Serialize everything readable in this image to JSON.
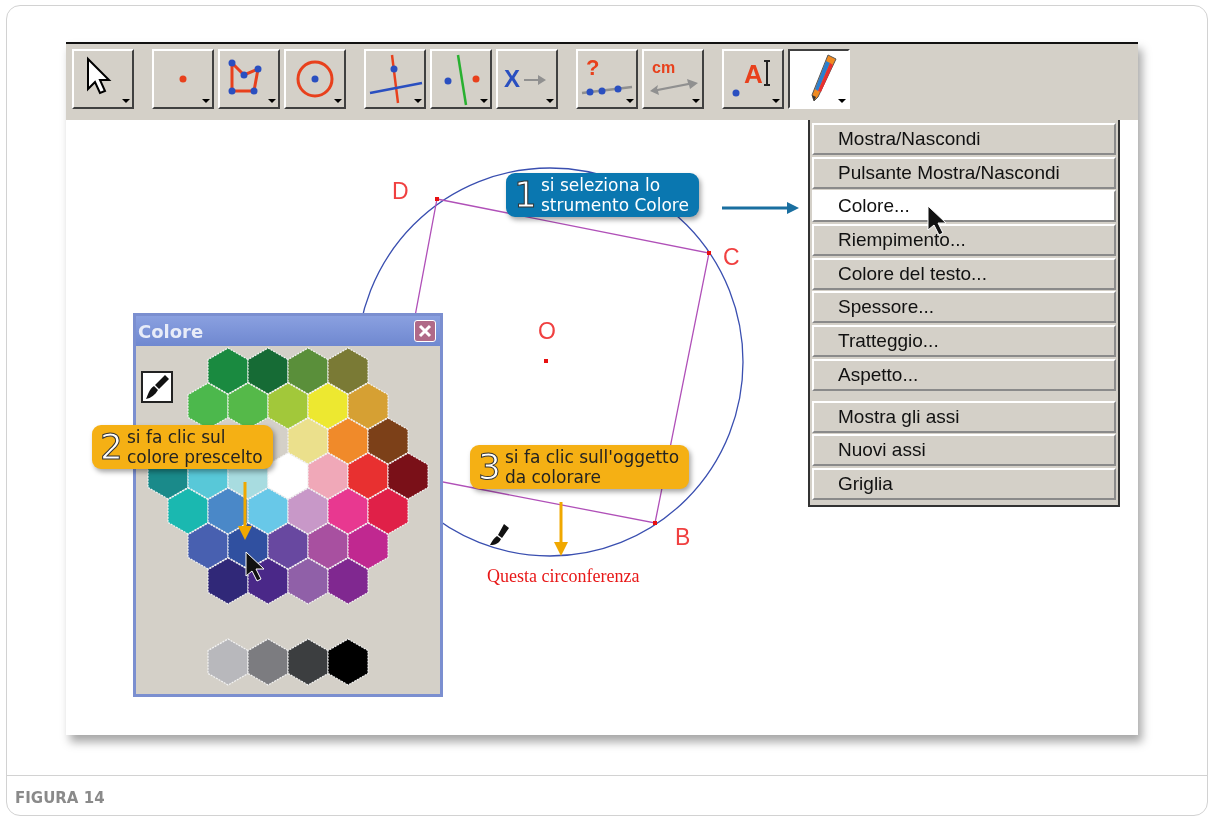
{
  "toolbar": {
    "groups": [
      [
        {
          "kind": "pointer",
          "selected": false
        }
      ],
      [
        {
          "kind": "point",
          "selected": false
        },
        {
          "kind": "polygon",
          "selected": false
        },
        {
          "kind": "circle",
          "selected": false
        }
      ],
      [
        {
          "kind": "perpendicular",
          "selected": false
        },
        {
          "kind": "parallel",
          "selected": false
        },
        {
          "kind": "symmetry",
          "text": "X",
          "selected": false
        }
      ],
      [
        {
          "kind": "question",
          "text": "?",
          "selected": false
        },
        {
          "kind": "measure",
          "text": "cm",
          "selected": false
        }
      ],
      [
        {
          "kind": "label",
          "text": "A",
          "selected": false
        },
        {
          "kind": "pencil",
          "selected": true
        }
      ]
    ]
  },
  "construction": {
    "points": [
      {
        "label": "D"
      },
      {
        "label": "C"
      },
      {
        "label": "O"
      },
      {
        "label": "B"
      }
    ],
    "caption": "Questa circonferenza"
  },
  "color_window": {
    "title": "Colore",
    "palette": [
      [
        {
          "color": "#1a8a40"
        },
        {
          "color": "#166b35"
        },
        {
          "color": "#5a8f3a"
        },
        {
          "color": "#7a7a35"
        }
      ],
      [
        {
          "color": "#4cb84c"
        },
        {
          "color": "#55b949"
        },
        {
          "color": "#a2c83a"
        },
        {
          "color": "#ede830"
        },
        {
          "color": "#d6a033"
        }
      ],
      [
        {
          "color": "#ebe08c"
        },
        {
          "color": "#f08a2a"
        },
        {
          "color": "#7c4018"
        }
      ],
      [
        {
          "color": "#1a8a8a"
        },
        {
          "color": "#58c8d8"
        },
        {
          "color": "#a8dce0"
        },
        {
          "color": "#ffffff"
        },
        {
          "color": "#f0a8b8"
        },
        {
          "color": "#e83030"
        },
        {
          "color": "#7a1018"
        }
      ],
      [
        {
          "color": "#1ab8b0"
        },
        {
          "color": "#4a88c8"
        },
        {
          "color": "#68c8e8"
        },
        {
          "color": "#c898c8"
        },
        {
          "color": "#e83890"
        },
        {
          "color": "#e02048"
        }
      ],
      [
        {
          "color": "#4860b0"
        },
        {
          "color": "#3050a0"
        },
        {
          "color": "#6848a0"
        },
        {
          "color": "#a850a0"
        },
        {
          "color": "#c02890"
        }
      ],
      [
        {
          "color": "#302878"
        },
        {
          "color": "#4a2888"
        },
        {
          "color": "#9060a8"
        },
        {
          "color": "#802890"
        }
      ]
    ],
    "grays": [
      {
        "color": "#b8b8bc"
      },
      {
        "color": "#7c7c80"
      },
      {
        "color": "#3c3e40"
      },
      {
        "color": "#000000"
      }
    ]
  },
  "menu": {
    "groups": [
      [
        {
          "label": "Mostra/Nascondi",
          "selected": false
        },
        {
          "label": "Pulsante Mostra/Nascondi",
          "selected": false
        },
        {
          "label": "Colore...",
          "selected": true
        },
        {
          "label": "Riempimento...",
          "selected": false
        },
        {
          "label": "Colore del testo...",
          "selected": false
        },
        {
          "label": "Spessore...",
          "selected": false
        },
        {
          "label": "Tratteggio...",
          "selected": false
        },
        {
          "label": "Aspetto...",
          "selected": false
        }
      ],
      [
        {
          "label": "Mostra gli assi",
          "selected": false
        },
        {
          "label": "Nuovi assi",
          "selected": false
        },
        {
          "label": "Griglia",
          "selected": false
        }
      ]
    ]
  },
  "callouts": [
    {
      "number": "1",
      "lines": [
        "si seleziona lo",
        "strumento Colore"
      ],
      "color": "#0a77b0"
    },
    {
      "number": "2",
      "lines": [
        "si fa clic sul",
        "colore prescelto"
      ],
      "color": "#f5b014"
    },
    {
      "number": "3",
      "lines": [
        "si fa clic sull'oggetto",
        "da colorare"
      ],
      "color": "#f5b014"
    }
  ],
  "figure_caption": "FIGURA 14"
}
